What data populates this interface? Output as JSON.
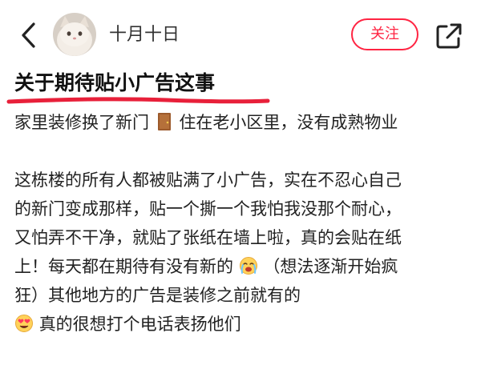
{
  "header": {
    "username": "十月十日",
    "follow_label": "关注"
  },
  "post": {
    "title": "关于期待贴小广告这事",
    "paragraph1": {
      "before_icon": "家里装修换了新门",
      "after_icon": "住在老小区里，没有成熟物业"
    },
    "paragraph2": {
      "line1": "这栋楼的所有人都被贴满了小广告，实在不忍心自己",
      "line2": "的新门变成那样，贴一个撕一个我怕我没那个耐心，",
      "line3": "又怕弄不干净，就贴了张纸在墙上啦，真的会贴在纸",
      "line4_before": "上！每天都在期待有没有新的",
      "line4_after": "（想法逐渐开始疯",
      "line5": "狂）其他地方的广告是装修之前就有的",
      "line6_after": "真的很想打个电话表扬他们"
    }
  },
  "icons": {
    "back": "chevron-left-icon",
    "share": "share-icon",
    "door": "door-emoji",
    "crying": "crying-face-emoji",
    "heart_face": "heart-eyes-face-emoji"
  },
  "colors": {
    "accent": "#ff2442",
    "text": "#222222",
    "underline": "#e8203a"
  }
}
